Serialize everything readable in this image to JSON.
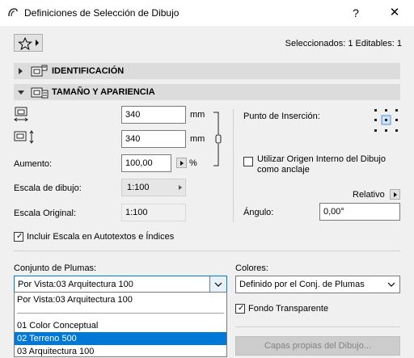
{
  "window": {
    "title": "Definiciones de Selección de Dibujo",
    "help": "?",
    "close": "✕"
  },
  "toolbar": {
    "selection_info": "Seleccionados: 1 Editables: 1"
  },
  "sections": {
    "identification": "IDENTIFICACIÓN",
    "size_appearance": "TAMAÑO Y APARIENCIA"
  },
  "size": {
    "width_value": "340",
    "width_unit": "mm",
    "height_value": "340",
    "height_unit": "mm",
    "magnification_label": "Aumento:",
    "magnification_value": "100,00",
    "magnification_unit": "%",
    "drawing_scale_label": "Escala de dibujo:",
    "drawing_scale_value": "1:100",
    "original_scale_label": "Escala Original:",
    "original_scale_value": "1:100"
  },
  "insertion": {
    "label": "Punto de Inserción:",
    "use_origin_label": "Utilizar Origen Interno del Dibujo como anclaje",
    "use_origin_checked": false,
    "relative_label": "Relativo",
    "angle_label": "Ángulo:",
    "angle_value": "0,00°"
  },
  "include_scale": {
    "label": "Incluir Escala en Autotextos e Índices",
    "checked": true
  },
  "pens": {
    "label": "Conjunto de Plumas:",
    "selected": "Por Vista:03 Arquitectura 100",
    "options": [
      "Por Vista:03 Arquitectura 100",
      "01 Color Conceptual",
      "02 Terreno 500",
      "03 Arquitectura 100"
    ],
    "highlighted_index": 2
  },
  "colors": {
    "label": "Colores:",
    "selected": "Definido por el Conj. de Plumas",
    "transparent_label": "Fondo Transparente",
    "transparent_checked": true,
    "layers_button": "Capas propias del Dibujo..."
  }
}
